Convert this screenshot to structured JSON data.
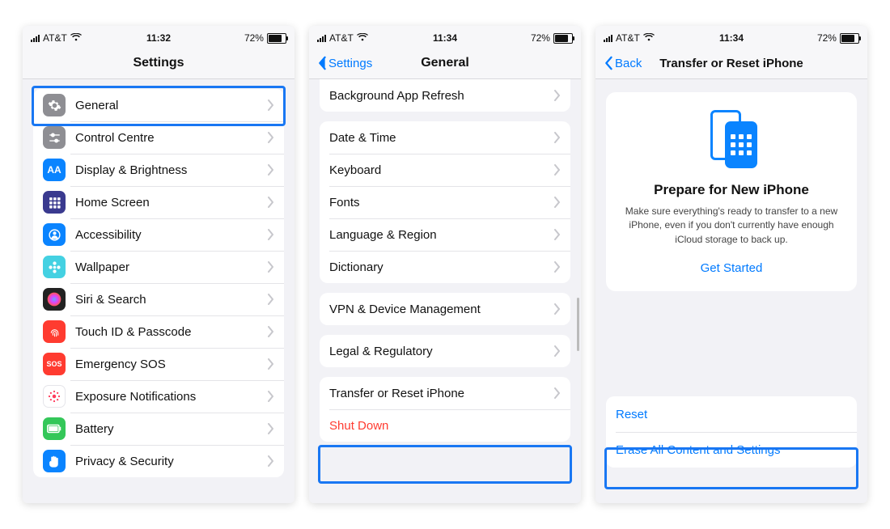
{
  "status": {
    "carrier": "AT&T",
    "battery_pct": "72%"
  },
  "screen1": {
    "time": "11:32",
    "title": "Settings",
    "items": [
      {
        "label": "General",
        "icon": "gear",
        "bg": "#8e8e93"
      },
      {
        "label": "Control Centre",
        "icon": "sliders",
        "bg": "#8e8e93"
      },
      {
        "label": "Display & Brightness",
        "icon": "AA",
        "bg": "#0a84ff",
        "text": true
      },
      {
        "label": "Home Screen",
        "icon": "grid",
        "bg": "#3a3a8f"
      },
      {
        "label": "Accessibility",
        "icon": "person",
        "bg": "#0a84ff"
      },
      {
        "label": "Wallpaper",
        "icon": "flower",
        "bg": "#44d1e2"
      },
      {
        "label": "Siri & Search",
        "icon": "siri",
        "bg": "#222"
      },
      {
        "label": "Touch ID & Passcode",
        "icon": "finger",
        "bg": "#ff3b30"
      },
      {
        "label": "Emergency SOS",
        "icon": "SOS",
        "bg": "#ff3b30",
        "text": true,
        "fs": "9px"
      },
      {
        "label": "Exposure Notifications",
        "icon": "burst",
        "bg": "#fff",
        "fg": "#ff3b5c",
        "border": true
      },
      {
        "label": "Battery",
        "icon": "battery",
        "bg": "#34c759"
      },
      {
        "label": "Privacy & Security",
        "icon": "hand",
        "bg": "#0a84ff"
      }
    ]
  },
  "screen2": {
    "time": "11:34",
    "back": "Settings",
    "title": "General",
    "group_top": [
      "Background App Refresh"
    ],
    "group_a": [
      "Date & Time",
      "Keyboard",
      "Fonts",
      "Language & Region",
      "Dictionary"
    ],
    "group_b": [
      "VPN & Device Management"
    ],
    "group_c": [
      "Legal & Regulatory"
    ],
    "group_d": [
      "Transfer or Reset iPhone",
      "Shut Down"
    ]
  },
  "screen3": {
    "time": "11:34",
    "back": "Back",
    "title": "Transfer or Reset iPhone",
    "card": {
      "heading": "Prepare for New iPhone",
      "body": "Make sure everything's ready to transfer to a new iPhone, even if you don't currently have enough iCloud storage to back up.",
      "cta": "Get Started"
    },
    "actions": {
      "reset": "Reset",
      "erase": "Erase All Content and Settings"
    }
  }
}
